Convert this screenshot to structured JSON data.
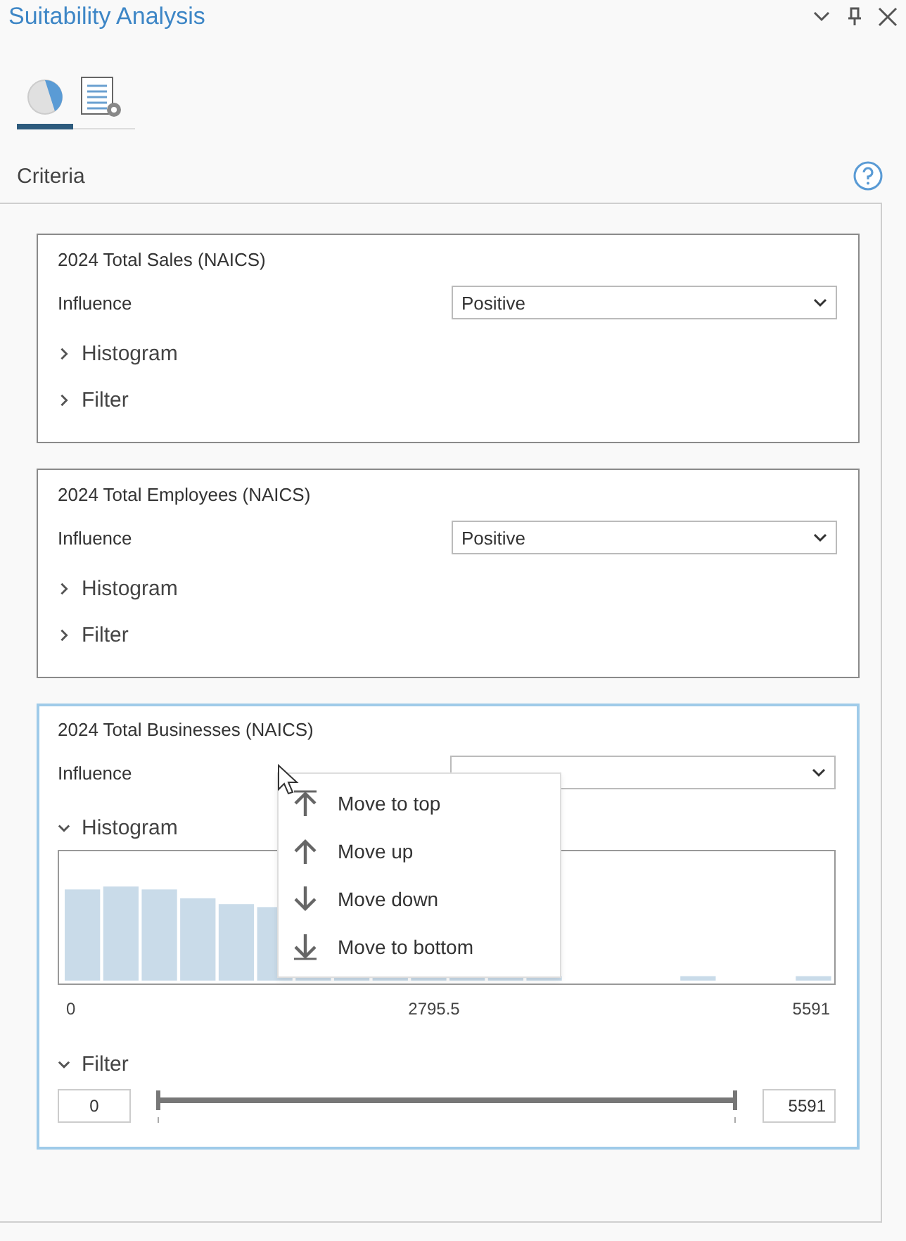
{
  "window": {
    "title": "Suitability Analysis"
  },
  "tabs": [
    {
      "kind": "chart",
      "selected": true
    },
    {
      "kind": "settings-list",
      "selected": false
    }
  ],
  "section": {
    "title": "Criteria"
  },
  "criteria": [
    {
      "title": "2024 Total Sales (NAICS)",
      "influence_label": "Influence",
      "influence": "Positive",
      "selected": false,
      "histogram": {
        "label": "Histogram",
        "expanded": false
      },
      "filter": {
        "label": "Filter",
        "expanded": false
      }
    },
    {
      "title": "2024 Total Employees (NAICS)",
      "influence_label": "Influence",
      "influence": "Positive",
      "selected": false,
      "histogram": {
        "label": "Histogram",
        "expanded": false
      },
      "filter": {
        "label": "Filter",
        "expanded": false
      }
    },
    {
      "title": "2024 Total Businesses (NAICS)",
      "influence_label": "Influence",
      "selected": true,
      "histogram": {
        "label": "Histogram",
        "expanded": true,
        "axis_labels": [
          "0",
          "2795.5",
          "5591"
        ]
      },
      "filter": {
        "label": "Filter",
        "expanded": true,
        "min": "0",
        "max": "5591",
        "level": 1
      }
    }
  ],
  "context_menu": [
    {
      "kind": "top",
      "label": "Move to top"
    },
    {
      "kind": "up",
      "label": "Move up"
    },
    {
      "kind": "down",
      "label": "Move down"
    },
    {
      "kind": "bottom",
      "label": "Move to bottom"
    }
  ]
}
